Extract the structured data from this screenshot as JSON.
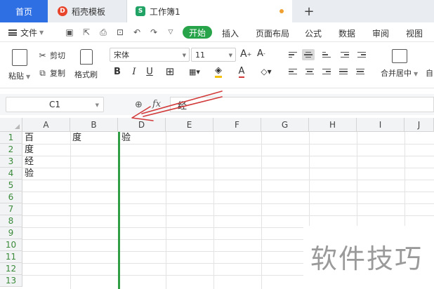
{
  "tabs": {
    "home": "首页",
    "docer": "稻壳模板",
    "workbook": "工作簿1"
  },
  "menu": {
    "file": "文件",
    "start": "开始",
    "insert": "插入",
    "page_layout": "页面布局",
    "formula": "公式",
    "data": "数据",
    "review": "审阅",
    "view": "视图"
  },
  "ribbon": {
    "paste": "粘贴",
    "cut": "剪切",
    "copy": "复制",
    "format_painter": "格式刷",
    "font_name": "宋体",
    "font_size": "11",
    "bold": "B",
    "italic": "I",
    "underline": "U",
    "merge_center": "合并居中",
    "auto_wrap_partial": "自"
  },
  "formula_bar": {
    "name_box": "C1",
    "fx": "fx",
    "value": "经"
  },
  "columns": [
    "A",
    "B",
    "D",
    "E",
    "F",
    "G",
    "H",
    "I",
    "J"
  ],
  "rows": [
    "1",
    "2",
    "3",
    "4",
    "5",
    "6",
    "7",
    "8",
    "9",
    "10",
    "11",
    "12",
    "13"
  ],
  "cells": {
    "A1": "百",
    "B1": "度",
    "D1": "验",
    "A2": "度",
    "A3": "经",
    "A4": "验"
  },
  "watermark": "软件技巧",
  "colors": {
    "home_tab": "#2f6fe4",
    "start_pill": "#27a34a",
    "selection": "#2f9e44",
    "arrow": "#d23a3a"
  }
}
